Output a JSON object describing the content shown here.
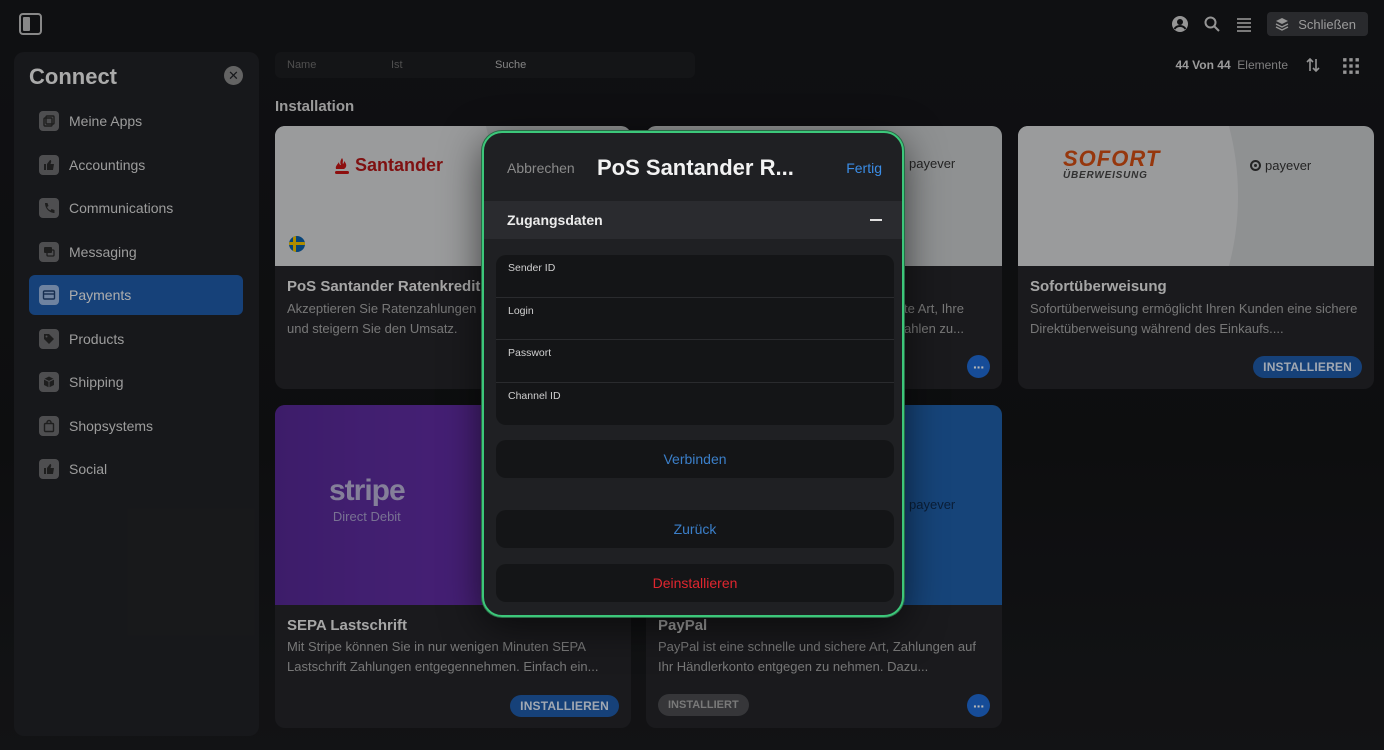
{
  "topbar": {
    "close_label": "Schließen",
    "icons": [
      "sidebar-toggle-icon",
      "account-icon",
      "search-icon",
      "menu-icon",
      "layers-icon"
    ]
  },
  "sidebar": {
    "title": "Connect",
    "items": [
      {
        "label": "Meine Apps",
        "icon": "apps-icon",
        "active": false
      },
      {
        "label": "Accountings",
        "icon": "thumbs-up-icon",
        "active": false
      },
      {
        "label": "Communications",
        "icon": "phone-icon",
        "active": false
      },
      {
        "label": "Messaging",
        "icon": "message-icon",
        "active": false
      },
      {
        "label": "Payments",
        "icon": "credit-card-icon",
        "active": true
      },
      {
        "label": "Products",
        "icon": "tag-icon",
        "active": false
      },
      {
        "label": "Shipping",
        "icon": "box-icon",
        "active": false
      },
      {
        "label": "Shopsystems",
        "icon": "shopping-bag-icon",
        "active": false
      },
      {
        "label": "Social",
        "icon": "thumbs-up-icon",
        "active": false
      }
    ]
  },
  "toolbar": {
    "search_col1": "Name",
    "search_col2": "Ist",
    "search_placeholder": "Suche",
    "count_value": "44 Von 44",
    "count_label": "Elemente"
  },
  "section": {
    "title": "Installation"
  },
  "cards": [
    {
      "logo": "Santander",
      "title": "PoS Santander Ratenkredit Schweden",
      "description": "Akzeptieren Sie Ratenzahlungen in Ihrem Ladengeschäft und steigern Sie den Umsatz."
    },
    {
      "logo": "payever",
      "title": "",
      "description": "te Art, Ihre ahlen zu..."
    },
    {
      "logo_top": "SOFORT",
      "logo_bottom": "ÜBERWEISUNG",
      "logo_right": "payever",
      "title": "Sofortüberweisung",
      "description": "Sofortüberweisung ermöglicht Ihren Kunden eine sichere Direktüberweisung während des Einkaufs....",
      "button": "INSTALLIEREN"
    },
    {
      "logo_top": "stripe",
      "logo_bottom": "Direct Debit",
      "title": "SEPA Lastschrift",
      "description": "Mit Stripe können Sie in nur wenigen Minuten SEPA Lastschrift Zahlungen entgegennehmen. Einfach ein...",
      "button": "INSTALLIEREN"
    },
    {
      "logo": "payever",
      "title": "PayPal",
      "description": "PayPal ist eine schnelle und sichere Art, Zahlungen auf Ihr Händlerkonto entgegen zu nehmen. Dazu...",
      "button": "INSTALLIERT"
    }
  ],
  "modal": {
    "cancel": "Abbrechen",
    "title": "PoS Santander R...",
    "done": "Fertig",
    "section_title": "Zugangsdaten",
    "fields": [
      {
        "label": "Sender ID",
        "value": ""
      },
      {
        "label": "Login",
        "value": ""
      },
      {
        "label": "Passwort",
        "value": ""
      },
      {
        "label": "Channel ID",
        "value": ""
      }
    ],
    "connect": "Verbinden",
    "back": "Zurück",
    "uninstall": "Deinstallieren"
  }
}
